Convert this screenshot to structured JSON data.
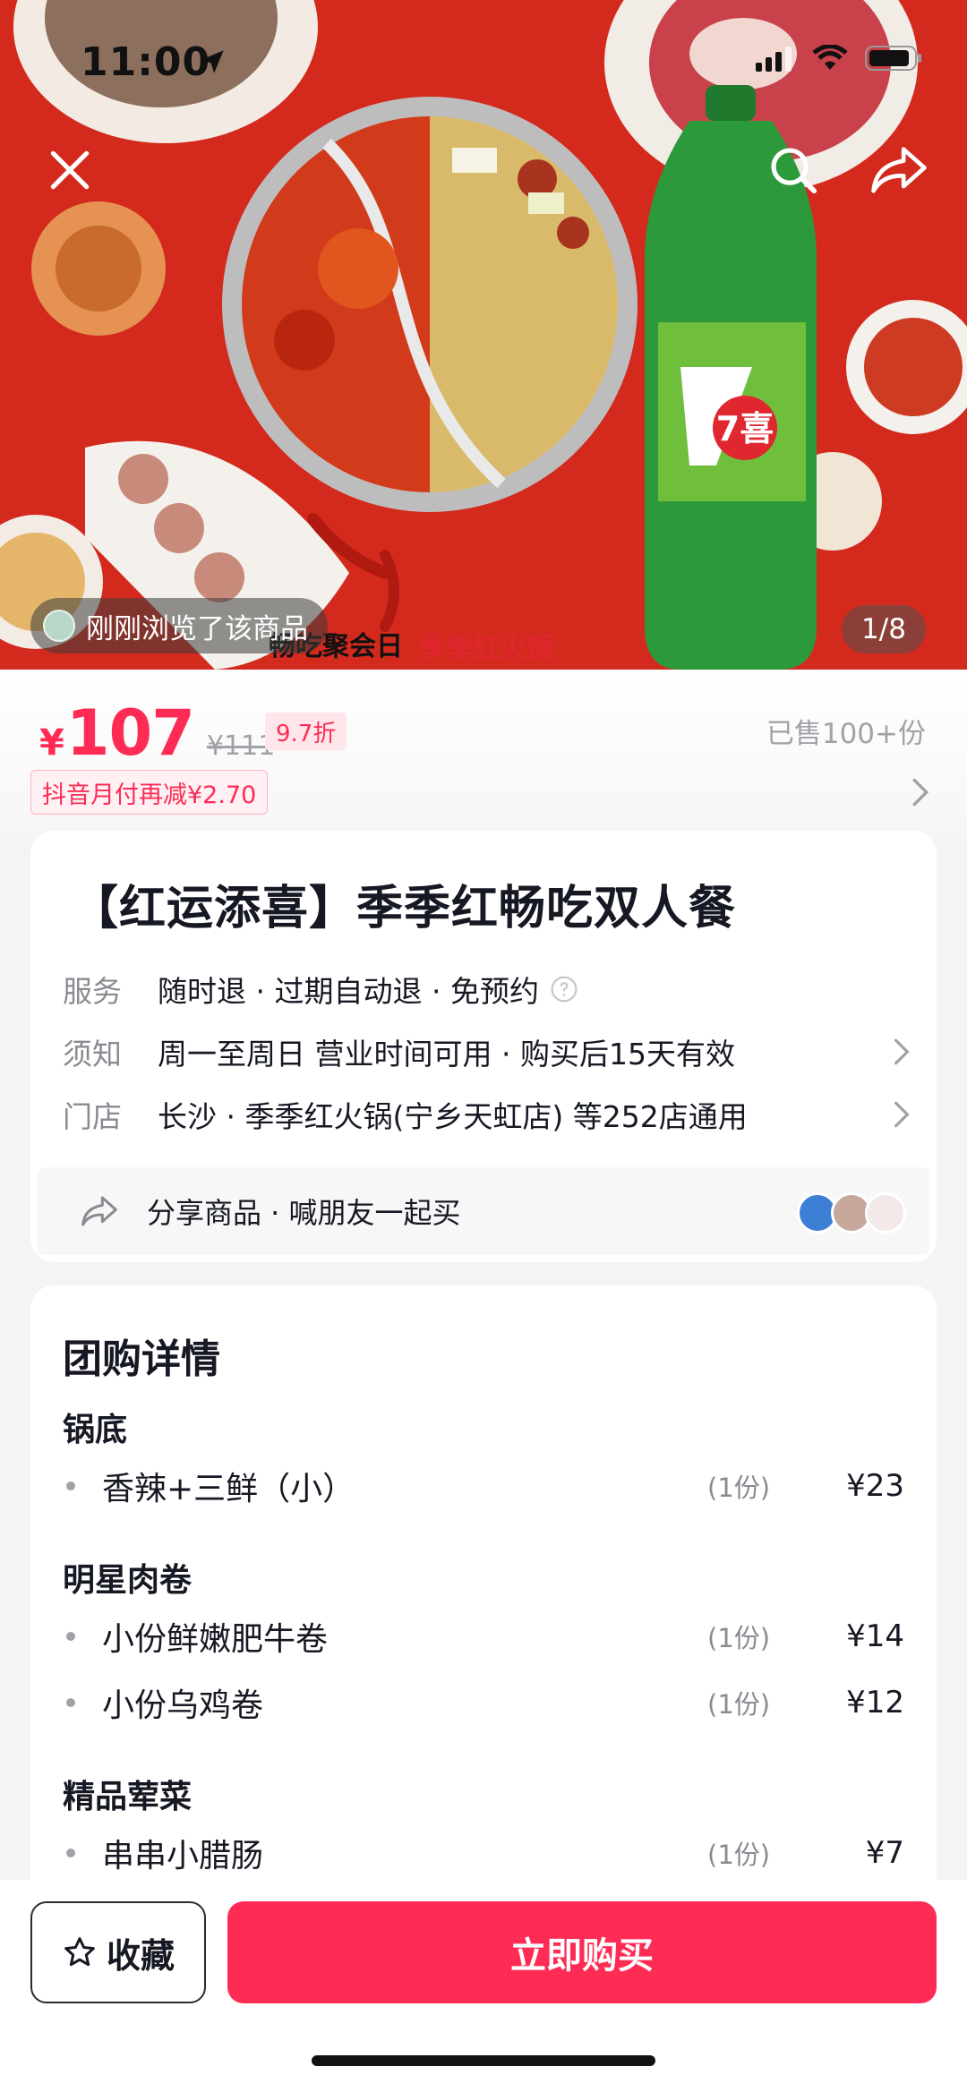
{
  "status_bar": {
    "time": "11:00"
  },
  "hero": {
    "seen_text": "刚刚浏览了该商品",
    "counter": "1/8",
    "banner_slogan": "畅吃聚会日",
    "banner_brand": "季季红火锅",
    "bottle_logo": "7喜"
  },
  "price": {
    "currency": "¥",
    "current": "107",
    "original": "¥111",
    "discount": "9.7折",
    "sold": "已售100+份",
    "promo": "抖音月付再减¥2.70"
  },
  "product": {
    "title": "【红运添喜】季季红畅吃双人餐",
    "rows": [
      {
        "label": "服务",
        "value": "随时退 · 过期自动退 · 免预约"
      },
      {
        "label": "须知",
        "value": "周一至周日 营业时间可用 · 购买后15天有效"
      },
      {
        "label": "门店",
        "value": "长沙 · 季季红火锅(宁乡天虹店) 等252店通用"
      }
    ],
    "share_text": "分享商品 · 喊朋友一起买"
  },
  "details": {
    "title": "团购详情",
    "sections": [
      {
        "title": "锅底",
        "items": [
          {
            "name": "香辣+三鲜（小）",
            "qty": "(1份)",
            "price": "¥23"
          }
        ]
      },
      {
        "title": "明星肉卷",
        "items": [
          {
            "name": "小份鲜嫩肥牛卷",
            "qty": "(1份)",
            "price": "¥14"
          },
          {
            "name": "小份乌鸡卷",
            "qty": "(1份)",
            "price": "¥12"
          }
        ]
      },
      {
        "title": "精品荤菜",
        "items": [
          {
            "name": "串串小腊肠",
            "qty": "(1份)",
            "price": "¥7"
          }
        ]
      }
    ]
  },
  "bottom_bar": {
    "favorite_label": "收藏",
    "buy_label": "立即购买"
  },
  "colors": {
    "accent": "#fe2c55",
    "hero_red": "#d9241c",
    "text": "#161823",
    "muted": "#8a8b91"
  },
  "icons": [
    "location-arrow-icon",
    "signal-icon",
    "wifi-icon",
    "battery-icon",
    "close-icon",
    "search-icon",
    "share-icon",
    "chevron-right-icon",
    "help-icon",
    "star-icon"
  ]
}
